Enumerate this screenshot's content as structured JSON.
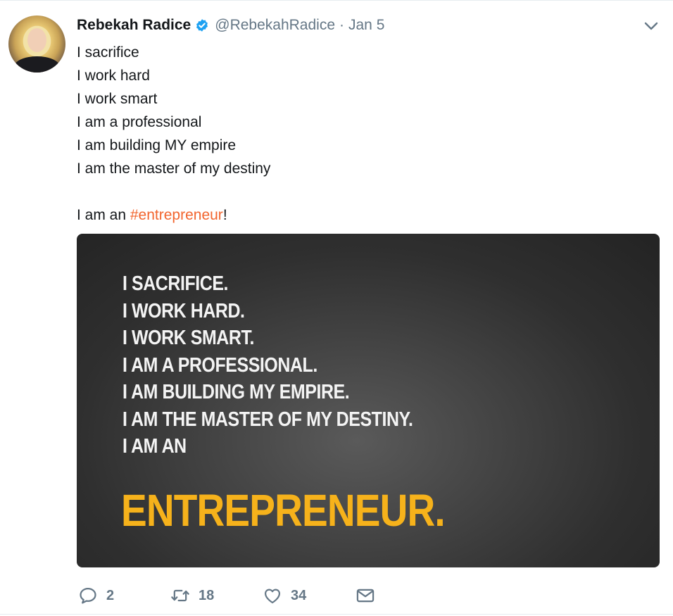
{
  "author": {
    "name": "Rebekah Radice",
    "handle": "@RebekahRadice",
    "separator": "·",
    "date": "Jan 5"
  },
  "tweet": {
    "lines": [
      "I sacrifice",
      "I work hard",
      "I work smart",
      "I am a professional",
      "I am building MY empire",
      "I am the master of my destiny"
    ],
    "closing_prefix": "I am an ",
    "hashtag": "#entrepreneur",
    "closing_suffix": "!"
  },
  "media": {
    "lines": [
      "I SACRIFICE.",
      "I WORK HARD.",
      "I WORK SMART.",
      "I AM A PROFESSIONAL.",
      "I AM BUILDING MY EMPIRE.",
      "I AM THE MASTER OF MY DESTINY.",
      "I AM AN"
    ],
    "headline": "ENTREPRENEUR."
  },
  "actions": {
    "replies": "2",
    "retweets": "18",
    "likes": "34"
  },
  "colors": {
    "hashtag": "#f2652e",
    "verified": "#1da1f2",
    "muted": "#657786",
    "headline": "#f6b21b"
  },
  "icons": [
    "verified-badge-icon",
    "chevron-down-icon",
    "reply-icon",
    "retweet-icon",
    "like-icon",
    "direct-message-icon"
  ]
}
